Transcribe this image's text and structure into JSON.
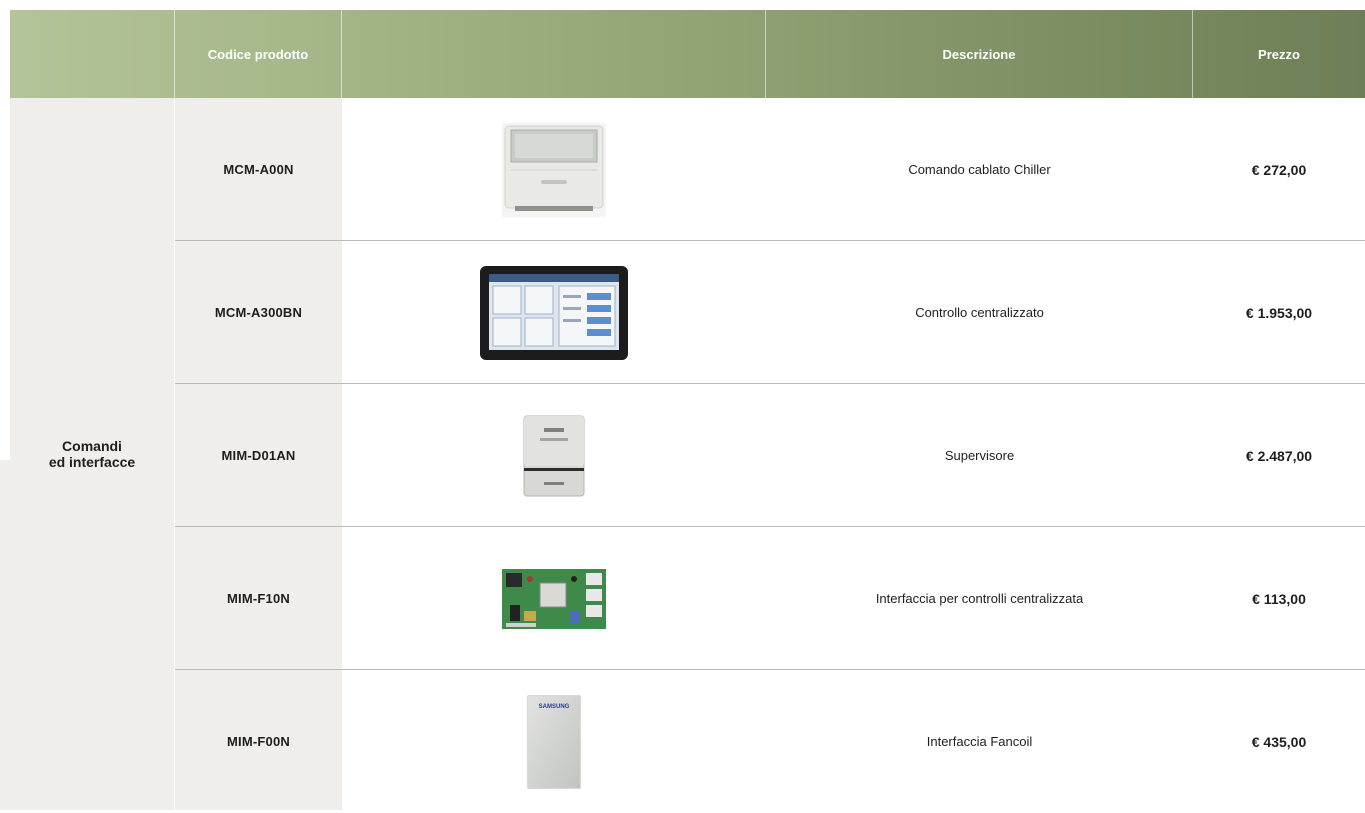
{
  "table": {
    "headers": {
      "category": "",
      "code": "Codice prodotto",
      "image": "",
      "description": "Descrizione",
      "price": "Prezzo"
    },
    "category": {
      "line1": "Comandi",
      "line2": "ed interfacce"
    },
    "rows": [
      {
        "code": "MCM-A00N",
        "description": "Comando cablato Chiller",
        "price": "€ 272,00",
        "image_icon": "wired-controller-image"
      },
      {
        "code": "MCM-A300BN",
        "description": "Controllo centralizzato",
        "price": "€ 1.953,00",
        "image_icon": "touch-tablet-controller-image"
      },
      {
        "code": "MIM-D01AN",
        "description": "Supervisore",
        "price": "€ 2.487,00",
        "image_icon": "supervisor-box-image"
      },
      {
        "code": "MIM-F10N",
        "description": "Interfaccia per controlli centralizzata",
        "price": "€ 113,00",
        "image_icon": "circuit-board-image"
      },
      {
        "code": "MIM-F00N",
        "description": "Interfaccia Fancoil",
        "price": "€ 435,00",
        "image_icon": "fancoil-interface-image"
      }
    ],
    "brand_text_on_product": "SAMSUNG"
  },
  "colors": {
    "header_start": "#b4c49a",
    "header_end": "#6e7f57",
    "side_bg": "#efeeeb"
  }
}
